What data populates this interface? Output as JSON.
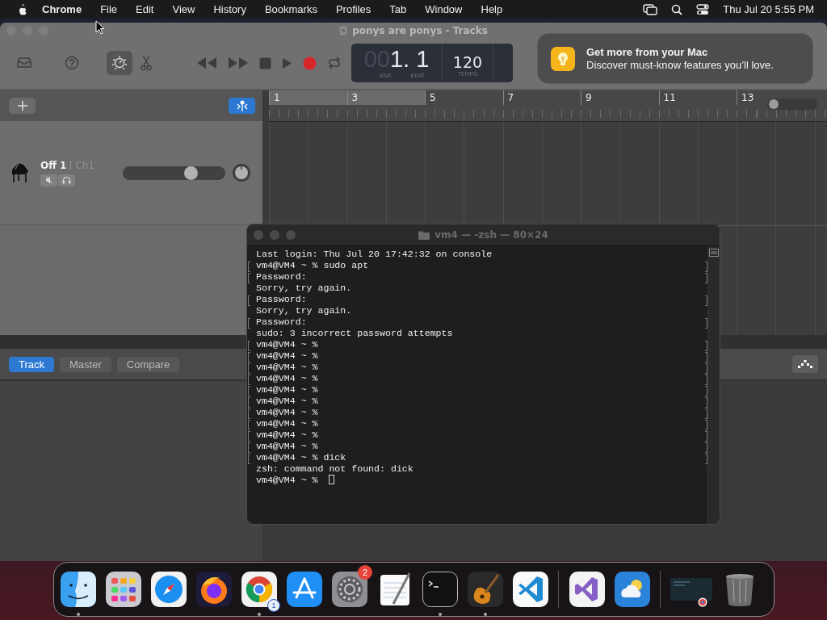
{
  "menu_bar": {
    "app": "Chrome",
    "items": [
      "File",
      "Edit",
      "View",
      "History",
      "Bookmarks",
      "Profiles",
      "Tab",
      "Window",
      "Help"
    ],
    "clock": "Thu Jul 20  5:55 PM"
  },
  "garageband": {
    "title": "ponys are ponys - Tracks",
    "tools": [
      {
        "kind": "library",
        "selected": false
      },
      {
        "kind": "help",
        "selected": false
      },
      {
        "kind": "smart-controls",
        "selected": true
      },
      {
        "kind": "scissors",
        "selected": false
      }
    ],
    "transport": [
      {
        "kind": "rewind"
      },
      {
        "kind": "forward"
      },
      {
        "kind": "stop"
      },
      {
        "kind": "play"
      },
      {
        "kind": "record"
      },
      {
        "kind": "cycle"
      }
    ],
    "lcd": {
      "bar_dim": "00",
      "position": "1. 1",
      "bar_label": "BAR",
      "beat_label": "BEAT",
      "tempo": "120",
      "tempo_label": "TEMPO"
    },
    "ruler": [
      "1",
      "3",
      "5",
      "7",
      "9",
      "11",
      "13"
    ],
    "zoom": {
      "level": 0
    },
    "track": {
      "name": "Off 1",
      "channel": "| Ch1",
      "volume": {
        "level": 0.7
      }
    },
    "tabs": [
      {
        "label": "Track",
        "selected": true
      },
      {
        "label": "Master",
        "selected": false
      },
      {
        "label": "Compare",
        "selected": false
      }
    ]
  },
  "terminal": {
    "title": "vm4 — -zsh — 80×24",
    "cursor": true,
    "lines": [
      {
        "text": "Last login: Thu Jul 20 17:42:32 on console",
        "marked": false
      },
      {
        "text": "vm4@VM4 ~ % sudo apt",
        "marked": true
      },
      {
        "text": "Password:",
        "marked": true
      },
      {
        "text": "Sorry, try again.",
        "marked": false
      },
      {
        "text": "Password:",
        "marked": true
      },
      {
        "text": "Sorry, try again.",
        "marked": false
      },
      {
        "text": "Password:",
        "marked": true
      },
      {
        "text": "sudo: 3 incorrect password attempts",
        "marked": false
      },
      {
        "text": "vm4@VM4 ~ %",
        "marked": true
      },
      {
        "text": "vm4@VM4 ~ %",
        "marked": true
      },
      {
        "text": "vm4@VM4 ~ %",
        "marked": true
      },
      {
        "text": "vm4@VM4 ~ %",
        "marked": true
      },
      {
        "text": "vm4@VM4 ~ %",
        "marked": true
      },
      {
        "text": "vm4@VM4 ~ %",
        "marked": true
      },
      {
        "text": "vm4@VM4 ~ %",
        "marked": true
      },
      {
        "text": "vm4@VM4 ~ %",
        "marked": true
      },
      {
        "text": "vm4@VM4 ~ %",
        "marked": true
      },
      {
        "text": "vm4@VM4 ~ %",
        "marked": true
      },
      {
        "text": "vm4@VM4 ~ % dick",
        "marked": true
      },
      {
        "text": "zsh: command not found: dick",
        "marked": false
      },
      {
        "text": "vm4@VM4 ~ %",
        "marked": false
      }
    ]
  },
  "notification": {
    "title": "Get more from your Mac",
    "body": "Discover must-know features you’ll love."
  },
  "dock": [
    {
      "kind": "finder",
      "running": true
    },
    {
      "kind": "launchpad",
      "running": false
    },
    {
      "kind": "safari",
      "running": false
    },
    {
      "kind": "firefox",
      "running": false
    },
    {
      "kind": "chrome",
      "running": true,
      "badge": "1"
    },
    {
      "kind": "appstore",
      "running": false
    },
    {
      "kind": "settings",
      "running": false,
      "badge": "2"
    },
    {
      "kind": "textedit",
      "running": false
    },
    {
      "kind": "terminal",
      "running": true
    },
    {
      "kind": "guitar",
      "running": true
    },
    {
      "kind": "vscode",
      "running": false
    },
    {
      "kind": "separator"
    },
    {
      "kind": "visualstudio",
      "running": false
    },
    {
      "kind": "weather",
      "running": false
    },
    {
      "kind": "separator"
    },
    {
      "kind": "window",
      "running": false
    },
    {
      "kind": "trash",
      "running": false
    }
  ]
}
